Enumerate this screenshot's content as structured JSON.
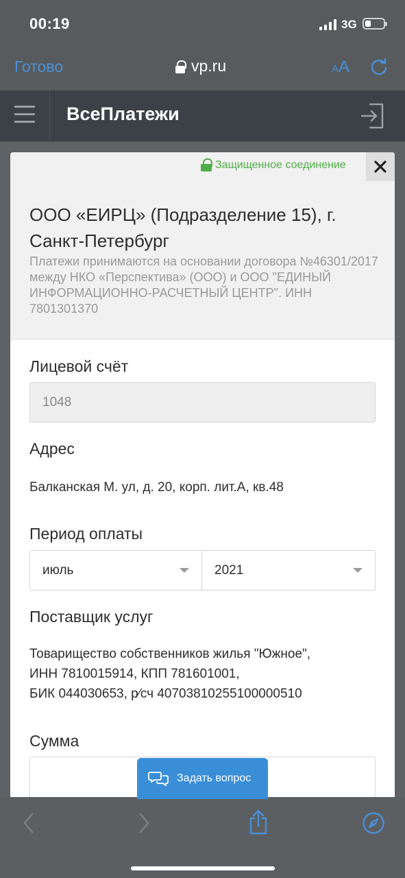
{
  "status_bar": {
    "time": "00:19",
    "network": "3G"
  },
  "browser": {
    "done_label": "Готово",
    "url": "vp.ru",
    "text_size_small": "A",
    "text_size_big": "A"
  },
  "site": {
    "title": "ВсеПлатежи"
  },
  "modal": {
    "secure_label": "Защищенное соединение",
    "org_name": "ООО «ЕИРЦ» (Подразделение 15), г. Санкт-Петербург",
    "org_description": "Платежи принимаются на основании договора №46301/2017 между НКО «Перспектива» (ООО) и ООО \"ЕДИНЫЙ ИНФОРМАЦИОННО-РАСЧЕТНЫЙ ЦЕНТР\". ИНН 7801301370",
    "account_label": "Лицевой счёт",
    "account_value": "1048",
    "address_label": "Адрес",
    "address_value": "Балканская М. ул, д. 20, корп. лит.А, кв.48",
    "period_label": "Период оплаты",
    "period_month": "июль",
    "period_year": "2021",
    "provider_label": "Поставщик услуг",
    "provider_line1": "Товарищество собственников жилья \"Южное\",",
    "provider_line2": "ИНН 7810015914, КПП 781601001,",
    "provider_line3": "БИК 044030653, р⁄сч 40703810255100000510",
    "sum_label": "Сумма"
  },
  "chat": {
    "ask_label": "Задать вопрос"
  },
  "colors": {
    "accent": "#3a8ed8",
    "secure": "#4fae47",
    "ios_blue": "#4a8fd6"
  }
}
